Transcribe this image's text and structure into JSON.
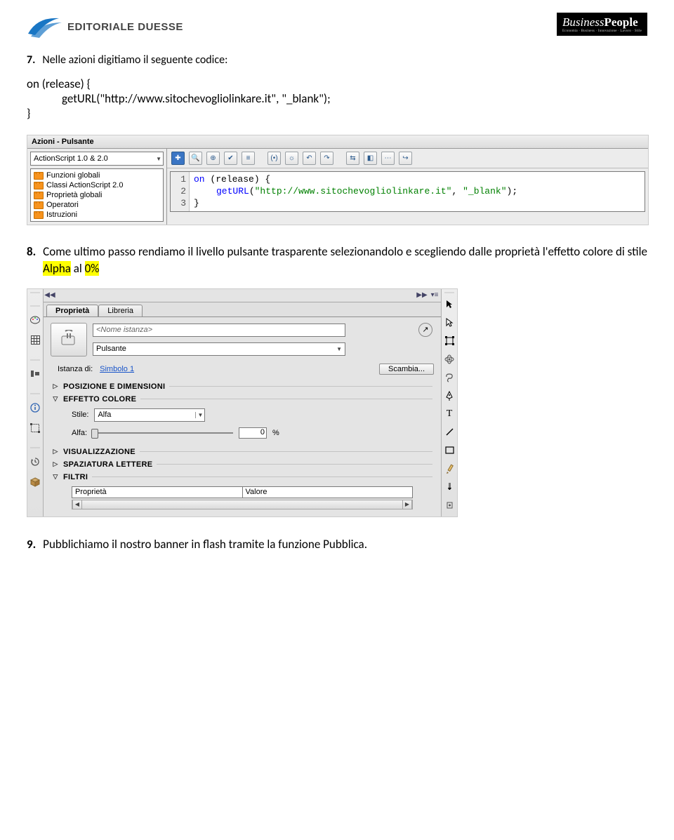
{
  "header": {
    "logo_left": "EDITORIALE DUESSE",
    "logo_right_a": "Business",
    "logo_right_b": "People"
  },
  "item7": {
    "num": "7.",
    "text": "Nelle azioni digitiamo il seguente codice:",
    "code_l1": "on (release) {",
    "code_l2": "getURL(\"http://www.sitochevogliolinkare.it\", \"_blank\");",
    "code_l3": "}"
  },
  "actions": {
    "title": "Azioni - Pulsante",
    "combo": "ActionScript 1.0 & 2.0",
    "tree": [
      "Funzioni globali",
      "Classi ActionScript 2.0",
      "Proprietà globali",
      "Operatori",
      "Istruzioni"
    ],
    "gutter": [
      "1",
      "2",
      "3"
    ],
    "c1_kw": "on",
    "c1_r": " (release) {",
    "c2_fn": "getURL",
    "c2_p": "(",
    "c2_s1": "\"http://www.sitochevogliolinkare.it\"",
    "c2_m": ", ",
    "c2_s2": "\"_blank\"",
    "c2_e": ");",
    "c3": "}"
  },
  "item8": {
    "num": "8.",
    "t1": "Come ultimo passo rendiamo il livello pulsante trasparente selezionandolo e scegliendo dalle proprietà l'effetto colore di stile ",
    "hl1": "Alpha",
    "t2": " al ",
    "hl2": "0%"
  },
  "props": {
    "tab1": "Proprietà",
    "tab2": "Libreria",
    "instance_ph": "<Nome istanza>",
    "type": "Pulsante",
    "inst_lbl": "Istanza di:",
    "inst_val": "Simbolo 1",
    "swap": "Scambia...",
    "sect_pos": "POSIZIONE E DIMENSIONI",
    "sect_eff": "EFFETTO COLORE",
    "style_lbl": "Stile:",
    "style_val": "Alfa",
    "alpha_lbl": "Alfa:",
    "alpha_val": "0",
    "alpha_unit": "%",
    "sect_vis": "VISUALIZZAZIONE",
    "sect_let": "SPAZIATURA LETTERE",
    "sect_fil": "FILTRI",
    "col1": "Proprietà",
    "col2": "Valore"
  },
  "item9": {
    "num": "9.",
    "text": "Pubblichiamo il nostro banner in flash tramite la funzione Pubblica."
  }
}
